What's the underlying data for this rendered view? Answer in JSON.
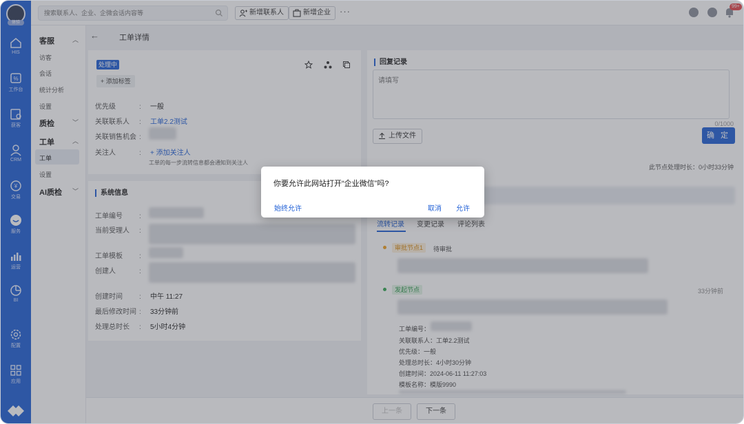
{
  "topbar": {
    "search_placeholder": "搜索联系人、企业、企微会话内容等",
    "add_contact": "新增联系人",
    "add_company": "新增企业",
    "more": "···",
    "badge": "99+"
  },
  "nav": {
    "avatar_tag": "体验",
    "items": [
      {
        "label": "HIS",
        "icon": "home-icon"
      },
      {
        "label": "工作台",
        "icon": "workbench-icon"
      },
      {
        "label": "获客",
        "icon": "acquire-icon"
      },
      {
        "label": "CRM",
        "icon": "user-icon"
      },
      {
        "label": "交易",
        "icon": "yuan-icon"
      },
      {
        "label": "服务",
        "icon": "chat-icon"
      },
      {
        "label": "运营",
        "icon": "chart-icon"
      },
      {
        "label": "BI",
        "icon": "pie-icon"
      },
      {
        "label": "配置",
        "icon": "gear-icon"
      },
      {
        "label": "应用",
        "icon": "apps-icon"
      }
    ]
  },
  "submenu": {
    "kefu": "客服",
    "kefu_items": [
      "访客",
      "会话",
      "统计分析",
      "设置"
    ],
    "zhijian": "质检",
    "gongdan": "工单",
    "gongdan_items": [
      "工单",
      "设置"
    ],
    "ai": "AI质检"
  },
  "breadcrumb": {
    "back": "←",
    "title": "工单详情"
  },
  "detail": {
    "status": "处理中",
    "add_tag": "+ 添加标签",
    "priority_label": "优先级",
    "priority_value": "一般",
    "contact_label": "关联联系人",
    "contact_value": "工单2.2测试",
    "opportunity_label": "关联销售机会",
    "follower_label": "关注人",
    "follower_value": "+ 添加关注人",
    "follower_hint": "工单的每一步流转信息都会通知到关注人",
    "colon": ":"
  },
  "system": {
    "title": "系统信息",
    "number_label": "工单编号",
    "assignee_label": "当前受理人",
    "template_label": "工单模板",
    "creator_label": "创建人",
    "created_label": "创建时间",
    "created_value": "中午 11:27",
    "modified_label": "最后修改时间",
    "modified_value": "33分钟前",
    "total_label": "处理总时长",
    "total_value": "5小时4分钟"
  },
  "reply": {
    "title": "回复记录",
    "placeholder": "请填写",
    "counter": "0/1000",
    "upload": "上传文件",
    "confirm": "确 定",
    "node_duration": "此节点处理时长：0小时33分钟"
  },
  "tabs": [
    "流转记录",
    "变更记录",
    "评论列表"
  ],
  "timeline": {
    "node1_tag": "审批节点1",
    "node1_status": "待审批",
    "node2_tag": "发起节点",
    "node2_time": "33分钟前",
    "detail_lines": [
      "工单编号：",
      "关联联系人：工单2.2测试",
      "优先级：一般",
      "处理总时长：4小时30分钟",
      "创建时间：2024-06-11 11:27:03",
      "模板名称：模版9990"
    ]
  },
  "pager": {
    "prev": "上一条",
    "next": "下一条"
  },
  "dialog": {
    "message": "你要允许此网站打开“企业微信”吗?",
    "always": "始终允许",
    "cancel": "取消",
    "allow": "允许"
  }
}
